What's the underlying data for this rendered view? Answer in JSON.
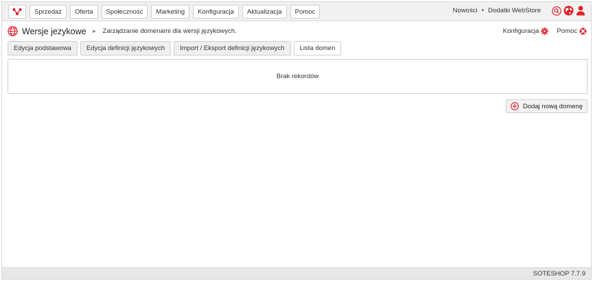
{
  "topbar": {
    "logo_icon": "soteshop-logo-icon",
    "nav": [
      {
        "label": "Sprzedaż"
      },
      {
        "label": "Oferta"
      },
      {
        "label": "Społeczność"
      },
      {
        "label": "Marketing"
      },
      {
        "label": "Konfiguracja"
      },
      {
        "label": "Aktualizacja"
      },
      {
        "label": "Pomoc"
      }
    ],
    "news_label": "Nowości",
    "separator": "•",
    "addons_label": "Dodatki WebStore",
    "icons": [
      "search-icon",
      "globe-icon",
      "user-icon"
    ]
  },
  "breadcrumb": {
    "icon": "globe-icon",
    "title": "Wersje jezykowe",
    "separator": "►",
    "description": "Zarządzanie domenami dla wersji językowych."
  },
  "header_links": {
    "config_label": "Konfiguracja",
    "help_label": "Pomoc"
  },
  "tabs": [
    {
      "label": "Edycja podstawowa",
      "active": false
    },
    {
      "label": "Edycja definicji językowych",
      "active": false
    },
    {
      "label": "Import / Eksport definicji językowych",
      "active": false
    },
    {
      "label": "Lista domen",
      "active": true
    }
  ],
  "records": {
    "empty_text": "Brak rekordów"
  },
  "add_button": {
    "label": "Dodaj nową domenę",
    "icon": "plus-circle-icon"
  },
  "footer": {
    "version": "SOTESHOP 7.7.9"
  },
  "colors": {
    "accent": "#e0202b",
    "topbar_bg": "#f1f1f1",
    "border": "#cfcfcf"
  }
}
